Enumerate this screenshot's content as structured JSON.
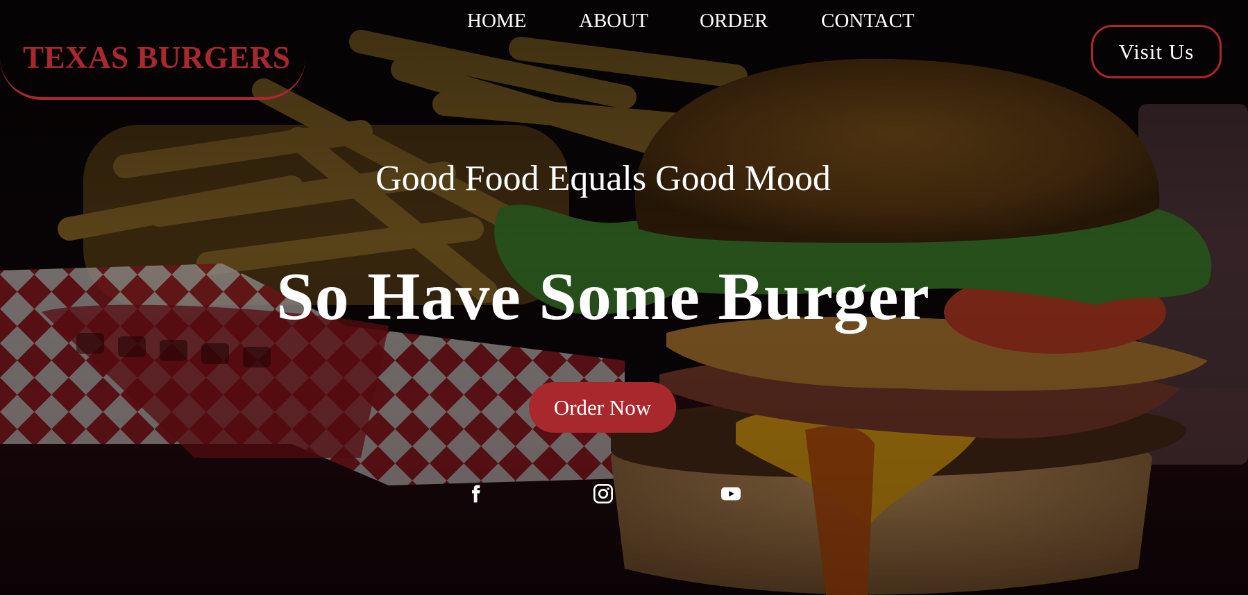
{
  "brand": {
    "name": "TEXAS BURGERS",
    "color": "#a8282d"
  },
  "nav": {
    "items": [
      {
        "label": "HOME"
      },
      {
        "label": "ABOUT"
      },
      {
        "label": "ORDER"
      },
      {
        "label": "CONTACT"
      }
    ]
  },
  "header": {
    "visit_label": "Visit Us"
  },
  "hero": {
    "tagline": "Good Food Equals Good Mood",
    "headline": "So Have Some Burger",
    "cta_label": "Order Now"
  },
  "social": {
    "icons": [
      "facebook-icon",
      "instagram-icon",
      "youtube-icon"
    ]
  },
  "colors": {
    "accent": "#a8282d",
    "text": "#ffffff",
    "background": "#000000"
  }
}
